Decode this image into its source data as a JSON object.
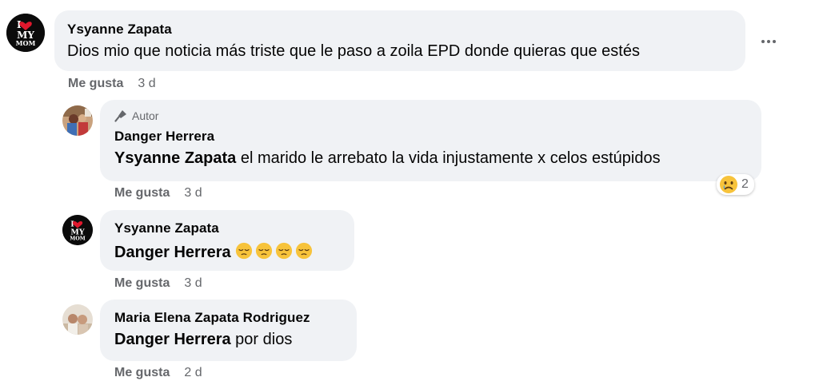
{
  "comments": [
    {
      "author": "Ysyanne Zapata",
      "text": "Dios mio que noticia más triste que le paso a zoila EPD donde quieras que estés",
      "like_label": "Me gusta",
      "time": "3 d"
    },
    {
      "badge": "Autor",
      "author": "Danger Herrera",
      "mention": "Ysyanne Zapata",
      "text": " el marido le arrebato la vida injustamente x celos estúpidos",
      "reaction_count": "2",
      "like_label": "Me gusta",
      "time": "3 d"
    },
    {
      "author": "Ysyanne Zapata",
      "mention": "Danger Herrera",
      "emoji_count": 4,
      "like_label": "Me gusta",
      "time": "3 d"
    },
    {
      "author": "Maria Elena Zapata Rodriguez",
      "mention": "Danger Herrera",
      "text": " por dios",
      "like_label": "Me gusta",
      "time": "2 d"
    }
  ],
  "icons": {
    "more": "more-horizontal-icon",
    "badge": "microphone-icon",
    "reaction": "sad-face-emoji",
    "pensive": "pensive-face-emoji"
  },
  "avatar_art": {
    "mom_line1": "I",
    "mom_line2": "MY",
    "mom_line3": "MOM"
  }
}
